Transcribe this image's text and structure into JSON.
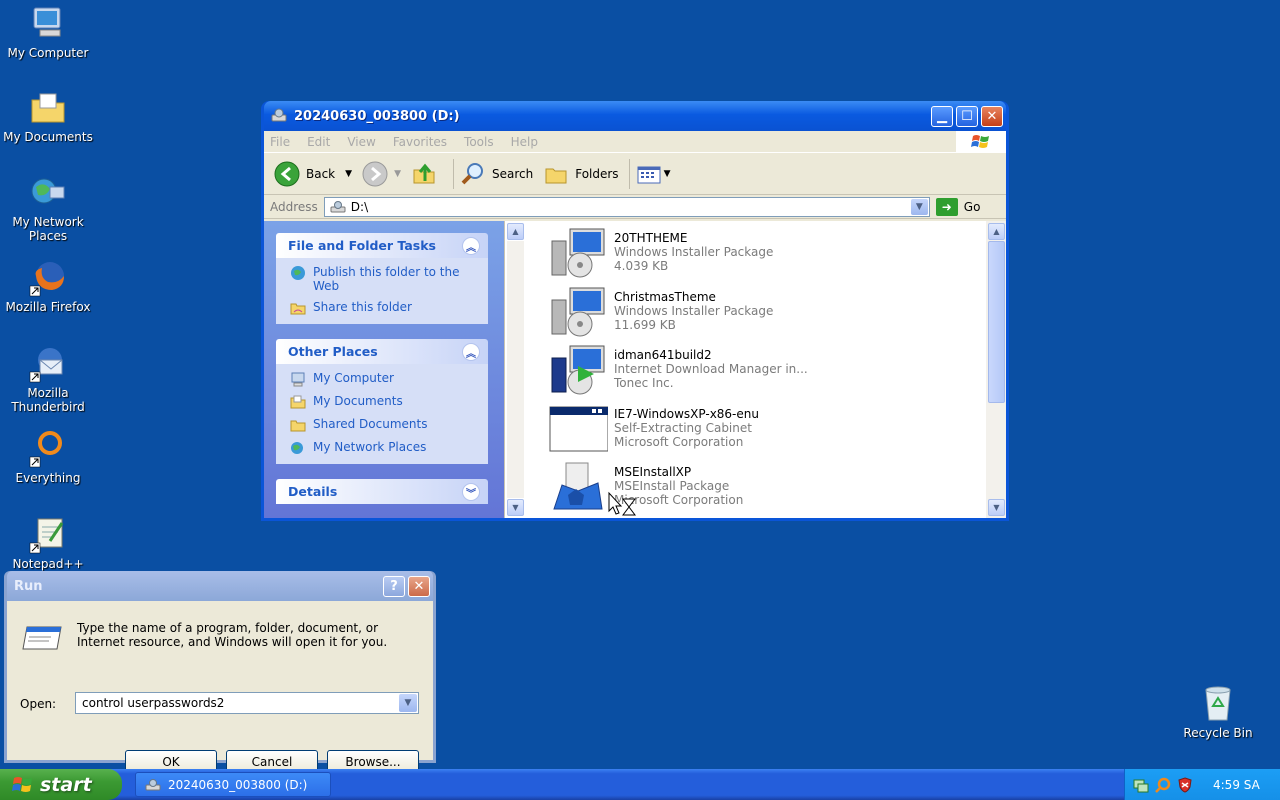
{
  "desktop": {
    "icons": [
      {
        "label": "My Computer",
        "icon": "my-computer-icon"
      },
      {
        "label": "My Documents",
        "icon": "my-documents-icon"
      },
      {
        "label": "My Network Places",
        "icon": "network-places-icon"
      },
      {
        "label": "Mozilla Firefox",
        "icon": "firefox-icon"
      },
      {
        "label": "Mozilla Thunderbird",
        "icon": "thunderbird-icon"
      },
      {
        "label": "Everything",
        "icon": "everything-icon"
      },
      {
        "label": "Notepad++",
        "icon": "notepadpp-icon"
      },
      {
        "label": "Recycle Bin",
        "icon": "recycle-bin-icon"
      }
    ]
  },
  "explorer": {
    "title": "20240630_003800 (D:)",
    "menu": [
      "File",
      "Edit",
      "View",
      "Favorites",
      "Tools",
      "Help"
    ],
    "toolbar": {
      "back": "Back",
      "search": "Search",
      "folders": "Folders"
    },
    "address": {
      "label": "Address",
      "value": "D:\\",
      "go": "Go"
    },
    "tasks": {
      "file_folder_title": "File and Folder Tasks",
      "file_folder_links": [
        "Publish this folder to the Web",
        "Share this folder"
      ],
      "other_places_title": "Other Places",
      "other_places_links": [
        "My Computer",
        "My Documents",
        "Shared Documents",
        "My Network Places"
      ],
      "details_title": "Details"
    },
    "files": [
      {
        "name": "20THTHEME",
        "line2": "Windows Installer Package",
        "line3": "4.039 KB",
        "icon": "msi-package-icon"
      },
      {
        "name": "ChristmasTheme",
        "line2": "Windows Installer Package",
        "line3": "11.699 KB",
        "icon": "msi-package-icon"
      },
      {
        "name": "idman641build2",
        "line2": "Internet Download Manager in...",
        "line3": "Tonec Inc.",
        "icon": "idm-installer-icon"
      },
      {
        "name": "IE7-WindowsXP-x86-enu",
        "line2": "Self-Extracting Cabinet",
        "line3": "Microsoft Corporation",
        "icon": "cabinet-window-icon"
      },
      {
        "name": "MSEInstallXP",
        "line2": "MSEInstall Package",
        "line3": "Microsoft Corporation",
        "icon": "mse-installer-icon"
      }
    ]
  },
  "run_dialog": {
    "title": "Run",
    "description": "Type the name of a program, folder, document, or Internet resource, and Windows will open it for you.",
    "open_label": "Open:",
    "open_value": "control userpasswords2",
    "ok": "OK",
    "cancel": "Cancel",
    "browse": "Browse...",
    "help_button": "?",
    "close_button": "✕"
  },
  "taskbar": {
    "start": "start",
    "task_button": "20240630_003800 (D:)",
    "clock": "4:59 SA"
  },
  "colors": {
    "desktop": "#0a4fa3",
    "xp_blue": "#0a55d8",
    "link_blue": "#215dc6",
    "start_green": "#3c9a33"
  }
}
